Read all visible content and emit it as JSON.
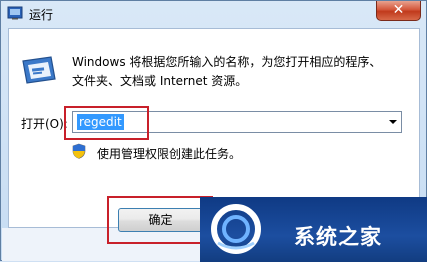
{
  "window": {
    "title": "运行",
    "close_glyph": "✕"
  },
  "dialog": {
    "description_line1": "Windows 将根据您所输入的名称，为您打开相应的程序、",
    "description_line2": "文件夹、文档或 Internet 资源。",
    "open_label": "打开(O):",
    "input_value": "regedit",
    "admin_note": "使用管理权限创建此任务。",
    "ok_label": "确定"
  },
  "watermark": {
    "text": "系统之家"
  },
  "colors": {
    "highlight_box": "#c8202a",
    "selection": "#3399ff",
    "watermark_bg": "#1c4ea0"
  },
  "icons": {
    "title": "run-app-icon",
    "main": "run-dialog-icon",
    "shield": "uac-shield-icon",
    "dropdown": "chevron-down-icon",
    "watermark": "watermark-logo-icon"
  }
}
